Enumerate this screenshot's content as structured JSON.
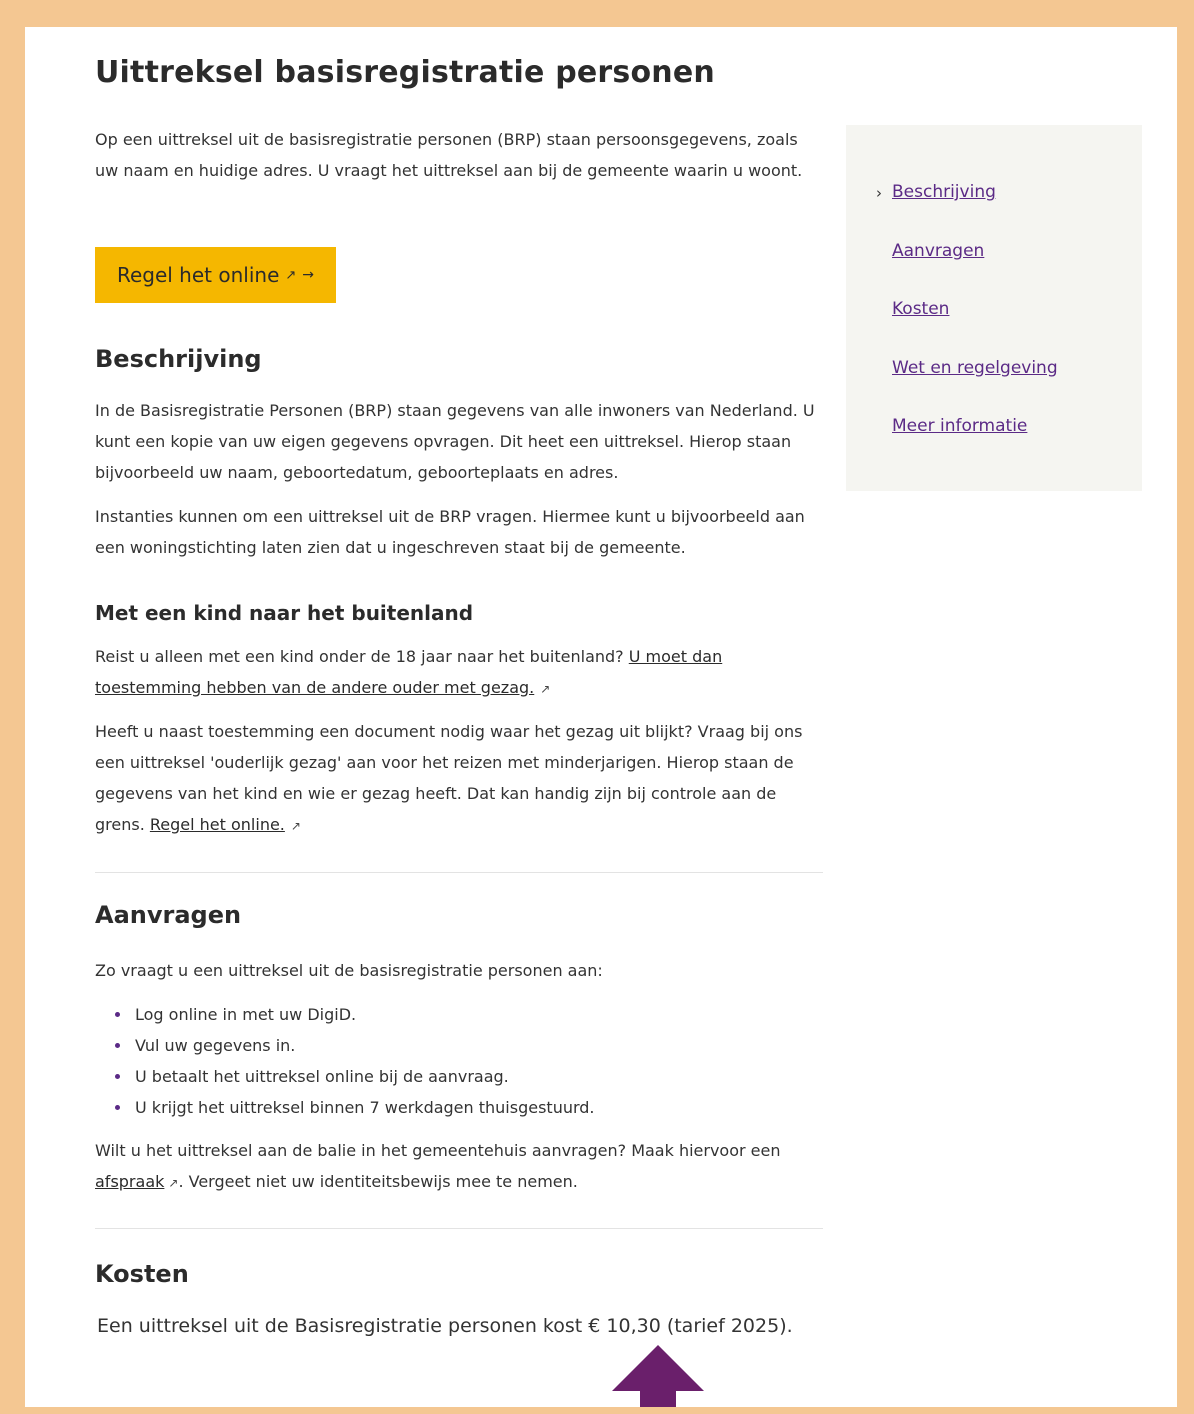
{
  "page": {
    "title": "Uittreksel basisregistratie personen",
    "intro": "Op een uittreksel uit de basisregistratie personen (BRP) staan persoonsgegevens, zoals uw naam en huidige adres. U vraagt het uittreksel aan bij de gemeente waarin u woont.",
    "cta_label": "Regel het online",
    "cta_ext_icon": "↗",
    "cta_arrow": "→"
  },
  "beschrijving": {
    "heading": "Beschrijving",
    "p1": "In de Basisregistratie Personen (BRP) staan gegevens van alle inwoners van Nederland. U kunt een kopie van uw eigen gegevens opvragen. Dit heet een uittreksel. Hierop staan bijvoorbeeld uw naam, geboortedatum, geboorteplaats en adres.",
    "p2": "Instanties kunnen om een uittreksel uit de BRP vragen. Hiermee kunt u bijvoorbeeld aan een woningstichting laten zien dat u ingeschreven staat bij de gemeente."
  },
  "kind": {
    "heading": "Met een kind naar het buitenland",
    "p1_text": "Reist u alleen met een kind onder de 18 jaar naar het buitenland? ",
    "p1_link": "U moet dan toestemming hebben van de andere ouder met gezag.",
    "p2_text": "Heeft u naast toestemming een document nodig waar het gezag uit blijkt? Vraag bij ons een uittreksel 'ouderlijk gezag' aan voor het reizen met minderjarigen. Hierop staan de gegevens van het kind en wie er gezag heeft. Dat kan handig zijn bij controle aan de grens. ",
    "p2_link": "Regel het online."
  },
  "aanvragen": {
    "heading": "Aanvragen",
    "intro": "Zo vraagt u een uittreksel uit de basisregistratie personen aan:",
    "steps": [
      "Log online in met uw DigiD.",
      "Vul uw gegevens in.",
      "U betaalt het uittreksel online bij de aanvraag.",
      "U krijgt het uittreksel binnen 7 werkdagen thuisgestuurd."
    ],
    "balie_text1": "Wilt u het uittreksel aan de balie in het gemeentehuis aanvragen? Maak hiervoor een ",
    "balie_link": "afspraak",
    "balie_text2": ". Vergeet niet uw identiteitsbewijs mee te nemen."
  },
  "kosten": {
    "heading": "Kosten",
    "text": "Een uittreksel uit de Basisregistratie personen kost € 10,30 (tarief 2025)."
  },
  "sidebar": {
    "items": [
      {
        "label": "Beschrijving",
        "active": true
      },
      {
        "label": "Aanvragen"
      },
      {
        "label": "Kosten"
      },
      {
        "label": "Wet en regelgeving"
      },
      {
        "label": "Meer informatie"
      }
    ],
    "chevron": "›"
  },
  "icons": {
    "external": "external-link-icon",
    "annotation": "arrow-up-icon"
  },
  "colors": {
    "frame": "#f4c792",
    "cta": "#f5b700",
    "link_purple": "#5b2a86",
    "annotation_arrow": "#6a1f6b"
  }
}
